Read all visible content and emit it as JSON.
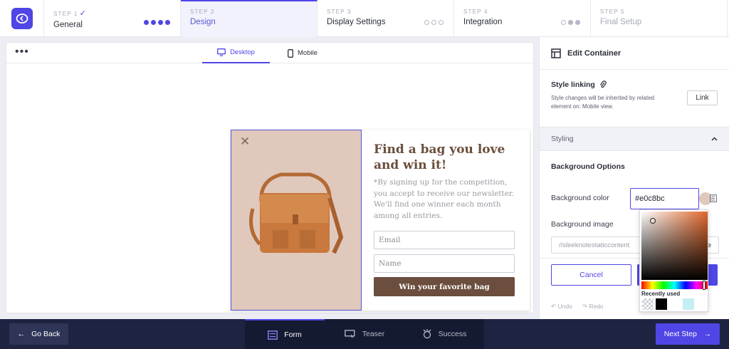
{
  "steps": [
    {
      "number": "STEP 1",
      "name": "General"
    },
    {
      "number": "STEP 2",
      "name": "Design"
    },
    {
      "number": "STEP 3",
      "name": "Display Settings"
    },
    {
      "number": "STEP 4",
      "name": "Integration"
    },
    {
      "number": "STEP 5",
      "name": "Final Setup"
    }
  ],
  "canvas": {
    "more_glyph": "•••",
    "desktop_tab": "Desktop",
    "mobile_tab": "Mobile"
  },
  "popup": {
    "title": "Find a bag you love and win it!",
    "description": "*By signing up for the competition, you accept to receive our newsletter. We'll find one winner each month among all entries.",
    "email_placeholder": "Email",
    "name_placeholder": "Name",
    "button_label": "Win your favorite bag",
    "background_color": "#e0c8bc",
    "button_color": "#6b4e3d"
  },
  "panel": {
    "title": "Edit Container",
    "style_linking_label": "Style linking",
    "style_linking_note": "Style changes will be inherited by related element on: Mobile view.",
    "link_button": "Link",
    "styling_label": "Styling",
    "background_options": "Background Options",
    "background_color_label": "Background color",
    "background_color_value": "#e0c8bc",
    "background_image_label": "Background image",
    "background_image_value": "//sleeknotestaticcontent",
    "background_image_trailing": "e",
    "cancel_button": "Cancel",
    "undo": "Undo",
    "redo": "Redo"
  },
  "picker": {
    "recently_used_label": "Recently used",
    "recent_colors": [
      "transparent",
      "#000000",
      "#ffffff",
      "#c5eef2"
    ]
  },
  "bottom": {
    "go_back": "Go Back",
    "tabs": [
      "Form",
      "Teaser",
      "Success"
    ],
    "next_step": "Next Step"
  },
  "colors": {
    "accent": "#4f46e5",
    "bottom_bar": "#1d2340"
  }
}
